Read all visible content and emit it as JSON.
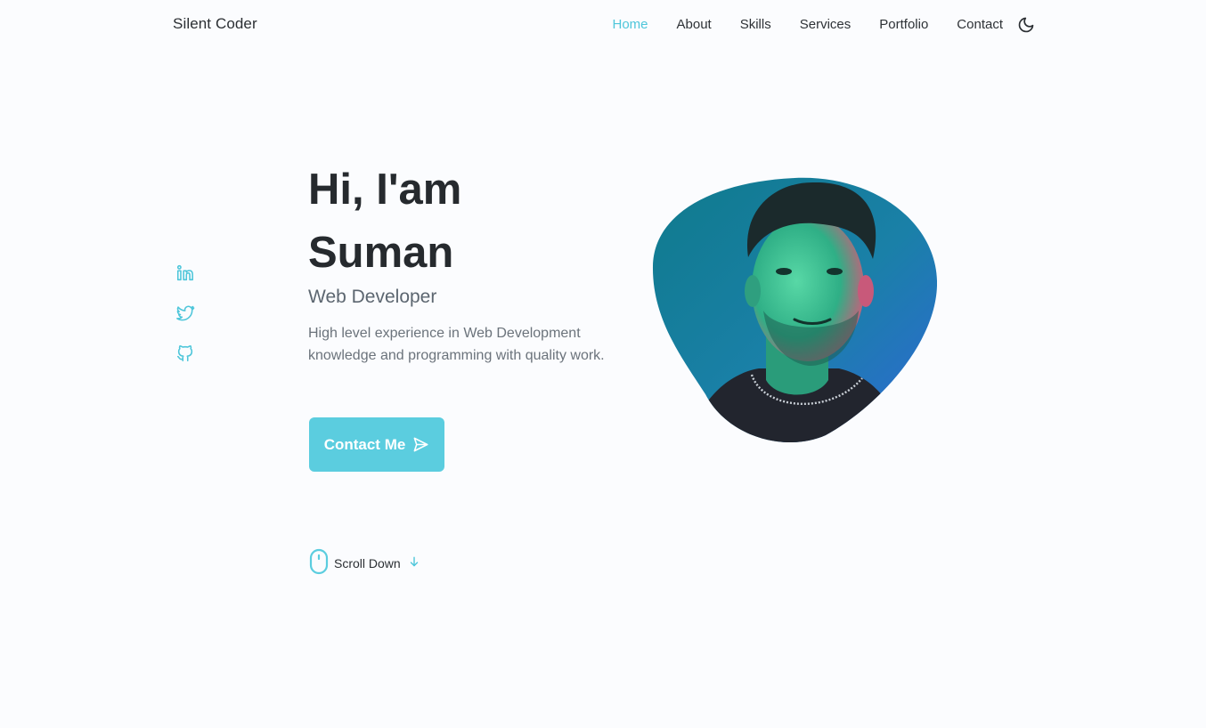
{
  "header": {
    "logo": "Silent Coder",
    "nav": [
      {
        "label": "Home",
        "active": true
      },
      {
        "label": "About",
        "active": false
      },
      {
        "label": "Skills",
        "active": false
      },
      {
        "label": "Services",
        "active": false
      },
      {
        "label": "Portfolio",
        "active": false
      },
      {
        "label": "Contact",
        "active": false
      }
    ],
    "theme_icon": "moon-icon"
  },
  "social": [
    {
      "icon": "linkedin-icon"
    },
    {
      "icon": "twitter-icon"
    },
    {
      "icon": "github-icon"
    }
  ],
  "hero": {
    "title_line1": "Hi, I'am",
    "title_line2": "Suman",
    "subtitle": "Web Developer",
    "description": "High level experience in Web Development knowledge and programming with quality work.",
    "button_label": "Contact Me",
    "button_icon": "send-icon",
    "scroll_label": "Scroll Down",
    "scroll_icon": "mouse-icon",
    "arrow_icon": "arrow-down-icon"
  },
  "colors": {
    "accent": "#5bcddf",
    "nav_active": "#4ec6da",
    "title": "#262a2e",
    "subtitle": "#5c6670",
    "background": "#fbfcfe"
  }
}
